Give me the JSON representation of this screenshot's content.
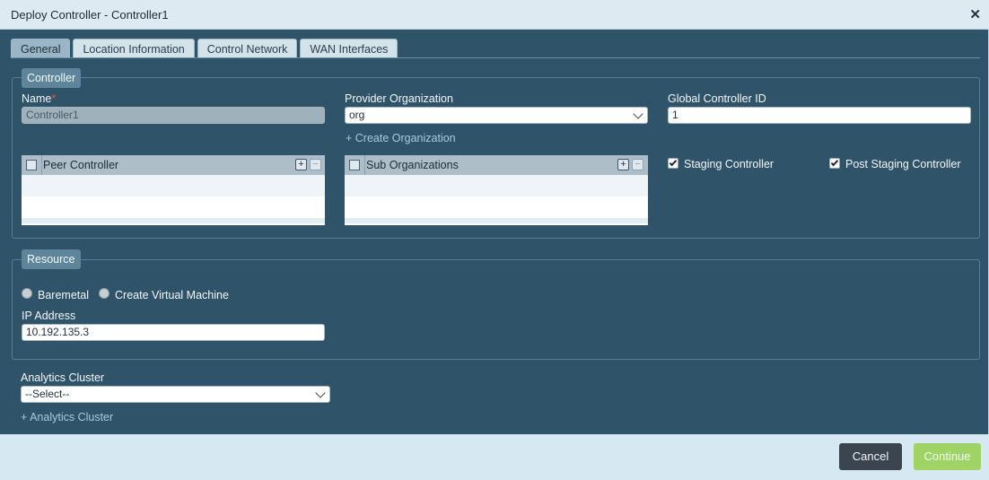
{
  "dialog": {
    "title": "Deploy Controller - Controller1",
    "close_glyph": "✕"
  },
  "tabs": [
    "General",
    "Location Information",
    "Control Network",
    "WAN Interfaces"
  ],
  "controller": {
    "legend": "Controller",
    "name_label": "Name",
    "required_mark": "*",
    "name_value": "Controller1",
    "provider_label": "Provider Organization",
    "provider_value": "org",
    "create_org_link": "+ Create Organization",
    "global_id_label": "Global Controller ID",
    "global_id_value": "1",
    "peer_grid_header": "Peer Controller",
    "sub_org_grid_header": "Sub Organizations",
    "add_glyph": "+",
    "remove_glyph": "−",
    "staging_label": "Staging Controller",
    "staging_checked": true,
    "post_staging_label": "Post Staging Controller",
    "post_staging_checked": true
  },
  "resource": {
    "legend": "Resource",
    "radio_baremetal": "Baremetal",
    "radio_vm": "Create Virtual Machine",
    "ip_label": "IP Address",
    "ip_value": "10.192.135.3"
  },
  "analytics": {
    "label": "Analytics Cluster",
    "select_value": "--Select--",
    "add_link": "+ Analytics Cluster"
  },
  "footer": {
    "cancel": "Cancel",
    "continue": "Continue"
  },
  "colors": {
    "body": "#2f5368",
    "titlebar": "#ddeaf2",
    "continue": "#9fd366",
    "cancel": "#3a4550"
  },
  "icons": {
    "close": "close-icon",
    "chevron": "chevron-down-icon",
    "add": "plus-icon",
    "remove": "minus-icon"
  }
}
